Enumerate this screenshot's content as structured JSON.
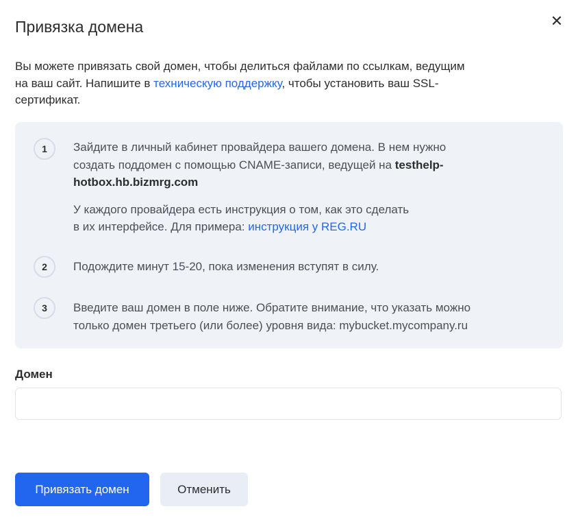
{
  "dialog": {
    "title": "Привязка домена",
    "close_icon": "close-icon",
    "intro": {
      "line1": "Вы можете привязать свой домен, чтобы делиться файлами по ссылкам, ведущим",
      "line2_before": "на ваш сайт. Напишите в ",
      "support_link": "техническую поддержку",
      "line2_after": ", чтобы установить ваш SSL-",
      "line3": "сертификат."
    },
    "steps": [
      {
        "number": "1",
        "line1": "Зайдите в личный кабинет провайдера вашего домена. В нем нужно",
        "line2": "создать поддомен с помощью CNAME-записи, ведущей на ",
        "domain_bold_1": "testhelp-",
        "domain_bold_2": "hotbox.hb.bizmrg.com",
        "note_line1": "У каждого провайдера есть инструкция о том, как это сделать",
        "note_line2": "в их интерфейсе. Для примера: ",
        "note_link": "инструкция у REG.RU"
      },
      {
        "number": "2",
        "line1": "Подождите минут 15-20, пока изменения вступят в силу."
      },
      {
        "number": "3",
        "line1": "Введите ваш домен в поле ниже. Обратите внимание, что указать можно",
        "line2": "только домен третьего (или более) уровня вида: mybucket.mycompany.ru"
      }
    ],
    "domain_field": {
      "label": "Домен",
      "value": "",
      "placeholder": ""
    },
    "buttons": {
      "submit": "Привязать домен",
      "cancel": "Отменить"
    },
    "colors": {
      "accent": "#2266f0",
      "box_bg": "#eff2f7",
      "secondary_bg": "#e9eef6"
    }
  }
}
